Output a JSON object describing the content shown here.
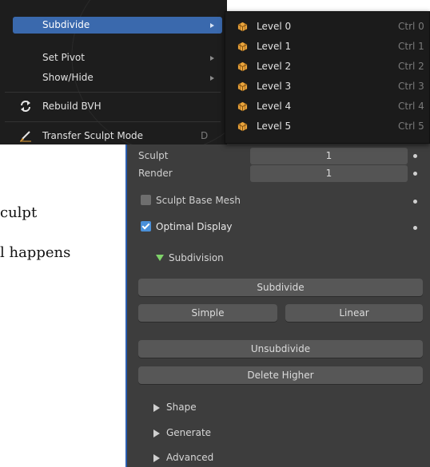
{
  "background_text": {
    "line1": "culpt",
    "line2": "l happens"
  },
  "menu": {
    "items": [
      {
        "label": "Subdivide",
        "has_submenu": true,
        "highlighted": true
      },
      {
        "label": "Set Pivot",
        "has_submenu": true
      },
      {
        "label": "Show/Hide",
        "has_submenu": true
      },
      {
        "label": "Rebuild BVH",
        "icon": "refresh-icon"
      },
      {
        "label": "Transfer Sculpt Mode",
        "icon": "brush-icon",
        "shortcut": "D"
      }
    ]
  },
  "submenu": {
    "items": [
      {
        "label": "Level 0",
        "shortcut": "Ctrl 0",
        "icon": "cube-grid-icon"
      },
      {
        "label": "Level 1",
        "shortcut": "Ctrl 1",
        "icon": "cube-grid-icon"
      },
      {
        "label": "Level 2",
        "shortcut": "Ctrl 2",
        "icon": "cube-grid-icon"
      },
      {
        "label": "Level 3",
        "shortcut": "Ctrl 3",
        "icon": "cube-grid-icon"
      },
      {
        "label": "Level 4",
        "shortcut": "Ctrl 4",
        "icon": "cube-grid-icon"
      },
      {
        "label": "Level 5",
        "shortcut": "Ctrl 5",
        "icon": "cube-grid-icon"
      }
    ]
  },
  "panel": {
    "sculpt_label": "Sculpt",
    "sculpt_value": "1",
    "render_label": "Render",
    "render_value": "1",
    "sculpt_base_mesh": {
      "label": "Sculpt Base Mesh",
      "checked": false
    },
    "optimal_display": {
      "label": "Optimal Display",
      "checked": true
    },
    "subdivision_header": "Subdivision",
    "subdivide_button": "Subdivide",
    "simple_button": "Simple",
    "linear_button": "Linear",
    "unsubdivide_button": "Unsubdivide",
    "delete_higher_button": "Delete Higher",
    "shape_header": "Shape",
    "generate_header": "Generate",
    "advanced_header": "Advanced"
  },
  "colors": {
    "panel_bg": "#3d3d3d",
    "menu_bg": "#1d1d1d",
    "highlight": "#3a69ad",
    "checkbox_on": "#4a90d9",
    "expand_triangle": "#7fd36a",
    "icon_orange": "#e8a33b"
  }
}
